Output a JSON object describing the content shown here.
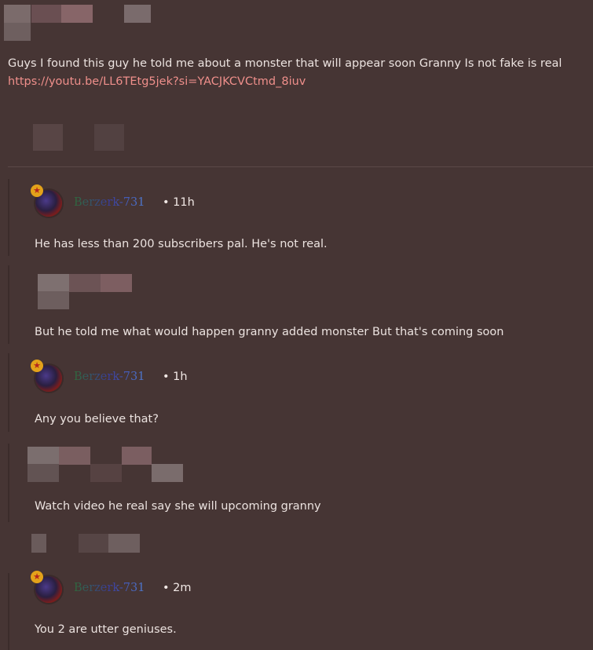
{
  "post": {
    "text": "Guys I found this guy he told me about a monster that will appear soon Granny Is not fake is real",
    "link": "https://youtu.be/LL6TEtg5jek?si=YACJKCVCtmd_8iuv"
  },
  "replies": [
    {
      "username": "Berzerk-731",
      "time": "11h",
      "text": "He has less than 200 subscribers pal. He's not real."
    },
    {
      "text": "But he told me what would happen granny added monster But that's coming soon"
    },
    {
      "username": "Berzerk-731",
      "time": "1h",
      "text": "Any you believe that?"
    },
    {
      "text": "Watch video he real say she will upcoming granny"
    },
    {
      "username": "Berzerk-731",
      "time": "2m",
      "text": "You 2 are utter geniuses."
    }
  ],
  "colors": {
    "background": "#463534",
    "link": "#ef8f8b",
    "text": "#ece3e0"
  },
  "icons": {
    "badge": "star-badge-icon",
    "separator": "dot-separator"
  }
}
